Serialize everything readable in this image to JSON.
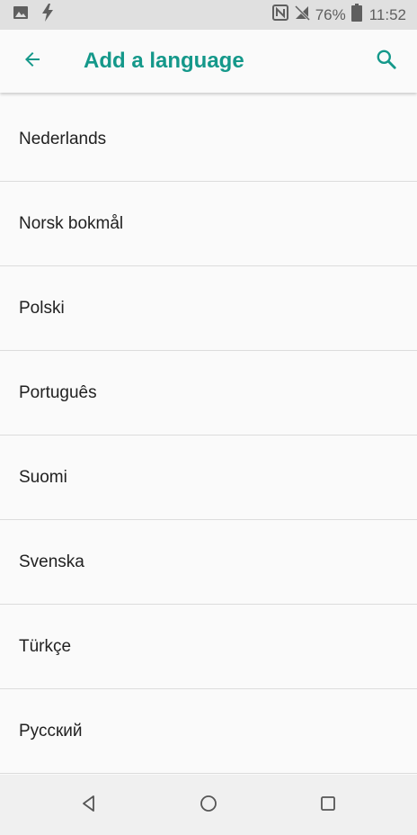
{
  "status_bar": {
    "battery_percent": "76%",
    "time": "11:52",
    "icons": [
      "image-icon",
      "flash-icon",
      "nfc-icon",
      "no-signal-icon",
      "battery-icon"
    ]
  },
  "app_bar": {
    "title": "Add a language",
    "accent_color": "#14988a",
    "back_icon": "arrow-left-icon",
    "search_icon": "search-icon"
  },
  "languages": [
    "Nederlands",
    "Norsk bokmål",
    "Polski",
    "Português",
    "Suomi",
    "Svenska",
    "Türkçe",
    "Русский"
  ],
  "nav_bar": {
    "icons": [
      "back-triangle-icon",
      "home-circle-icon",
      "recents-square-icon"
    ]
  }
}
